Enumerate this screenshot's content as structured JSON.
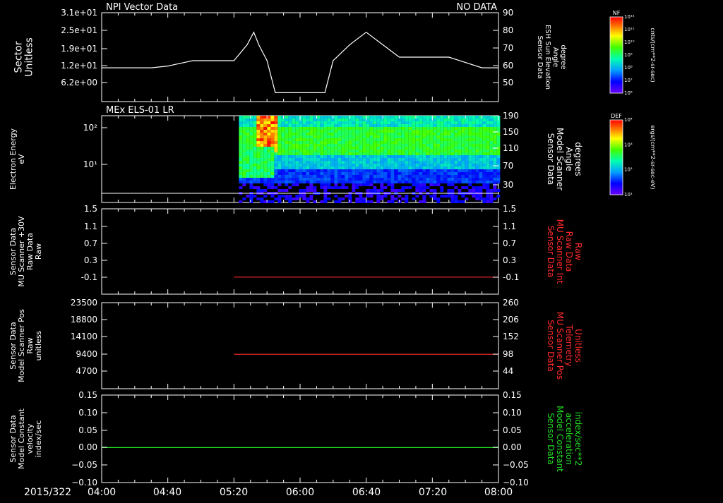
{
  "colors": {
    "bg": "#000000",
    "fg": "#ffffff",
    "red": "#ff2a2a",
    "green": "#22dd22"
  },
  "chart_data": [
    {
      "type": "line",
      "panel_label": "NPI Vector Data",
      "status_text": "NO DATA",
      "ylabel_left": [
        "Sector",
        "Unitless"
      ],
      "ylabel_right": [
        "Sensor Data",
        "ESH Sun Elevation",
        "Angle",
        "degree"
      ],
      "yticks_left": [
        "3.1e+01",
        "2.5e+01",
        "1.9e+01",
        "1.2e+01",
        "6.2e+00"
      ],
      "yticks_right": [
        "90",
        "80",
        "70",
        "60",
        "50"
      ],
      "right_ylim": [
        40,
        90
      ],
      "series": [
        {
          "axis": "right",
          "color": "white",
          "x": [
            0,
            10,
            20,
            30,
            40,
            45,
            50,
            55,
            58,
            62,
            66,
            70,
            75,
            80,
            88,
            92,
            95,
            100,
            105,
            110,
            120,
            125,
            130,
            135,
            140,
            150,
            160,
            170,
            180,
            190,
            200,
            210,
            220,
            230,
            240
          ],
          "y": [
            59,
            59,
            59,
            59,
            60,
            61,
            62,
            63,
            63,
            63,
            63,
            63,
            63,
            63,
            72,
            79,
            72,
            63,
            45,
            45,
            45,
            45,
            45,
            45,
            63,
            72,
            79,
            72,
            65,
            65,
            65,
            65,
            62,
            59,
            59
          ]
        }
      ]
    },
    {
      "type": "heatmap",
      "panel_label": "MEx ELS-01 LR",
      "ylabel_left": [
        "Electron Energy",
        "eV"
      ],
      "ylabel_right": [
        "Sensor Data",
        "Model Scanner",
        "Angle",
        "degrees"
      ],
      "yticks_left": [
        "10²",
        "10¹"
      ],
      "yticks_right": [
        "190",
        "150",
        "110",
        "70",
        "30"
      ],
      "colorbar_label": "DEF",
      "colorbar_unit": "ergs/(cm**2-sr-sec-eV)",
      "colorbar_ticks": [
        "10⁴",
        "10³",
        "10²",
        "10¹"
      ],
      "data_start_time": "05:23"
    },
    {
      "type": "line",
      "ylabel_left": [
        "Sensor Data",
        "MU Scanner +30V",
        "Raw Data",
        "Raw"
      ],
      "ylabel_right": [
        "Sensor Data",
        "MU Scanner Int",
        "Raw Data",
        "Raw"
      ],
      "yticks_left": [
        "1.5",
        "1.1",
        "0.7",
        "0.3",
        "-0.1"
      ],
      "yticks_right": [
        "1.5",
        "1.1",
        "0.7",
        "0.3",
        "-0.1"
      ],
      "ylim": [
        -0.5,
        1.5
      ],
      "series": [
        {
          "axis": "right",
          "color": "red",
          "x_start": "05:20",
          "x_end": "08:00",
          "y": -0.1
        }
      ]
    },
    {
      "type": "line",
      "ylabel_left": [
        "Sensor Data",
        "Model Scanner Pos",
        "Raw",
        "unitless"
      ],
      "ylabel_right": [
        "Sensor Data",
        "MU Scanner Pos",
        "Telemetry",
        "Unitless"
      ],
      "yticks_left": [
        "23500",
        "18800",
        "14100",
        "9400",
        "4700"
      ],
      "yticks_right": [
        "260",
        "206",
        "152",
        "98",
        "44"
      ],
      "right_ylim": [
        -10,
        260
      ],
      "series": [
        {
          "axis": "right",
          "color": "red",
          "x_start": "05:20",
          "x_end": "08:00",
          "y": 98
        }
      ]
    },
    {
      "type": "line",
      "ylabel_left": [
        "Sensor Data",
        "Model Constant",
        "velocity",
        "index/sec"
      ],
      "ylabel_right": [
        "Sensor Data",
        "Model Constant",
        "acceleration",
        "index/sec**2"
      ],
      "yticks_left": [
        "0.15",
        "0.10",
        "0.05",
        "0.00",
        "−0.05",
        "−0.10"
      ],
      "yticks_right": [
        "0.15",
        "0.10",
        "0.05",
        "0.00",
        "−0.05",
        "−0.10"
      ],
      "ylim": [
        -0.1,
        0.15
      ],
      "series": [
        {
          "axis": "right",
          "color": "green",
          "x_start": "04:00",
          "x_end": "08:00",
          "y": 0.0
        }
      ]
    }
  ],
  "top_colorbar": {
    "label": "NF",
    "unit": "cnts/(cm**2-sr-sec)",
    "ticks": [
      "10¹²",
      "10¹¹",
      "10¹⁰",
      "10⁹",
      "10⁸",
      "10⁷",
      "10⁶"
    ]
  },
  "time_axis": {
    "date": "2015/322",
    "ticks": [
      "04:00",
      "04:40",
      "05:20",
      "06:00",
      "06:40",
      "07:20",
      "08:00"
    ]
  }
}
